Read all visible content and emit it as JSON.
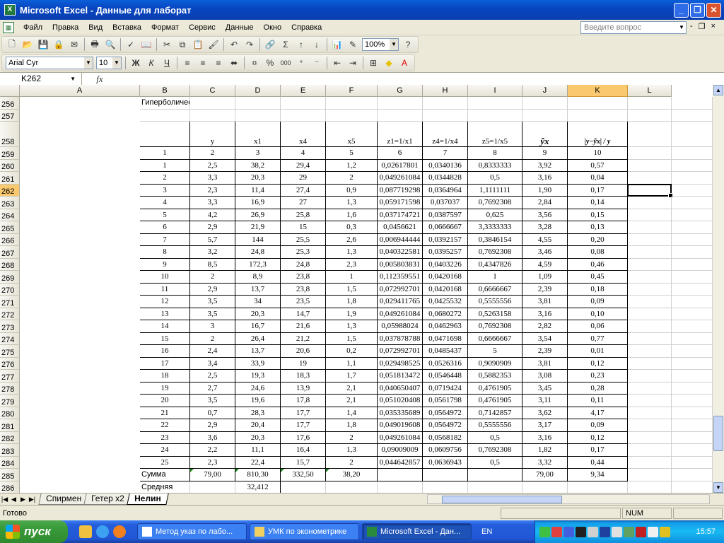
{
  "window": {
    "title": "Microsoft Excel - Данные для лаборат",
    "btn_min": "_",
    "btn_max": "❐",
    "btn_close": "✕"
  },
  "menu": {
    "items": [
      "Файл",
      "Правка",
      "Вид",
      "Вставка",
      "Формат",
      "Сервис",
      "Данные",
      "Окно",
      "Справка"
    ],
    "ask_placeholder": "Введите вопрос",
    "win_min": "-",
    "win_restore": "❐",
    "win_close": "×"
  },
  "toolbar": {
    "zoom": "100%",
    "font": "Arial Cyr",
    "size": "10",
    "bold": "Ж",
    "italic": "К",
    "underline": "Ч",
    "sum": "Σ",
    "percent": "%",
    "thousands": "000"
  },
  "formula": {
    "cell_ref": "K262",
    "fx": "fx",
    "content": ""
  },
  "columns": [
    "A",
    "B",
    "C",
    "D",
    "E",
    "F",
    "G",
    "H",
    "I",
    "J",
    "K",
    "L"
  ],
  "active_column": "K",
  "active_row": "262",
  "rows": [
    {
      "n": "256",
      "cells": [
        "Гиперболическая",
        "",
        "",
        "",
        "",
        "",
        "",
        "",
        "",
        "",
        ""
      ]
    },
    {
      "n": "257",
      "cells": [
        "",
        "",
        "",
        "",
        "",
        "",
        "",
        "",
        "",
        "",
        ""
      ]
    },
    {
      "n": "258",
      "cells": [
        "",
        "y",
        "x1",
        "x4",
        "x5",
        "z1=1/x1",
        "z4=1/x4",
        "z5=1/x5",
        "ỹx",
        "|y−ỹx| / y",
        ""
      ]
    },
    {
      "n": "259",
      "cells": [
        "1",
        "2",
        "3",
        "4",
        "5",
        "6",
        "7",
        "8",
        "9",
        "10",
        ""
      ]
    },
    {
      "n": "260",
      "cells": [
        "1",
        "2,5",
        "38,2",
        "29,4",
        "1,2",
        "0,02617801",
        "0,0340136",
        "0,8333333",
        "3,92",
        "0,57",
        ""
      ]
    },
    {
      "n": "261",
      "cells": [
        "2",
        "3,3",
        "20,3",
        "29",
        "2",
        "0,049261084",
        "0,0344828",
        "0,5",
        "3,16",
        "0,04",
        ""
      ]
    },
    {
      "n": "262",
      "cells": [
        "3",
        "2,3",
        "11,4",
        "27,4",
        "0,9",
        "0,087719298",
        "0,0364964",
        "1,1111111",
        "1,90",
        "0,17",
        ""
      ]
    },
    {
      "n": "263",
      "cells": [
        "4",
        "3,3",
        "16,9",
        "27",
        "1,3",
        "0,059171598",
        "0,037037",
        "0,7692308",
        "2,84",
        "0,14",
        ""
      ]
    },
    {
      "n": "264",
      "cells": [
        "5",
        "4,2",
        "26,9",
        "25,8",
        "1,6",
        "0,037174721",
        "0,0387597",
        "0,625",
        "3,56",
        "0,15",
        ""
      ]
    },
    {
      "n": "265",
      "cells": [
        "6",
        "2,9",
        "21,9",
        "15",
        "0,3",
        "0,0456621",
        "0,0666667",
        "3,3333333",
        "3,28",
        "0,13",
        ""
      ]
    },
    {
      "n": "266",
      "cells": [
        "7",
        "5,7",
        "144",
        "25,5",
        "2,6",
        "0,006944444",
        "0,0392157",
        "0,3846154",
        "4,55",
        "0,20",
        ""
      ]
    },
    {
      "n": "267",
      "cells": [
        "8",
        "3,2",
        "24,8",
        "25,3",
        "1,3",
        "0,040322581",
        "0,0395257",
        "0,7692308",
        "3,46",
        "0,08",
        ""
      ]
    },
    {
      "n": "268",
      "cells": [
        "9",
        "8,5",
        "172,3",
        "24,8",
        "2,3",
        "0,005803831",
        "0,0403226",
        "0,4347826",
        "4,59",
        "0,46",
        ""
      ]
    },
    {
      "n": "269",
      "cells": [
        "10",
        "2",
        "8,9",
        "23,8",
        "1",
        "0,112359551",
        "0,0420168",
        "1",
        "1,09",
        "0,45",
        ""
      ]
    },
    {
      "n": "270",
      "cells": [
        "11",
        "2,9",
        "13,7",
        "23,8",
        "1,5",
        "0,072992701",
        "0,0420168",
        "0,6666667",
        "2,39",
        "0,18",
        ""
      ]
    },
    {
      "n": "271",
      "cells": [
        "12",
        "3,5",
        "34",
        "23,5",
        "1,8",
        "0,029411765",
        "0,0425532",
        "0,5555556",
        "3,81",
        "0,09",
        ""
      ]
    },
    {
      "n": "272",
      "cells": [
        "13",
        "3,5",
        "20,3",
        "14,7",
        "1,9",
        "0,049261084",
        "0,0680272",
        "0,5263158",
        "3,16",
        "0,10",
        ""
      ]
    },
    {
      "n": "273",
      "cells": [
        "14",
        "3",
        "16,7",
        "21,6",
        "1,3",
        "0,05988024",
        "0,0462963",
        "0,7692308",
        "2,82",
        "0,06",
        ""
      ]
    },
    {
      "n": "274",
      "cells": [
        "15",
        "2",
        "26,4",
        "21,2",
        "1,5",
        "0,037878788",
        "0,0471698",
        "0,6666667",
        "3,54",
        "0,77",
        ""
      ]
    },
    {
      "n": "275",
      "cells": [
        "16",
        "2,4",
        "13,7",
        "20,6",
        "0,2",
        "0,072992701",
        "0,0485437",
        "5",
        "2,39",
        "0,01",
        ""
      ]
    },
    {
      "n": "276",
      "cells": [
        "17",
        "3,4",
        "33,9",
        "19",
        "1,1",
        "0,029498525",
        "0,0526316",
        "0,9090909",
        "3,81",
        "0,12",
        ""
      ]
    },
    {
      "n": "277",
      "cells": [
        "18",
        "2,5",
        "19,3",
        "18,3",
        "1,7",
        "0,051813472",
        "0,0546448",
        "0,5882353",
        "3,08",
        "0,23",
        ""
      ]
    },
    {
      "n": "278",
      "cells": [
        "19",
        "2,7",
        "24,6",
        "13,9",
        "2,1",
        "0,040650407",
        "0,0719424",
        "0,4761905",
        "3,45",
        "0,28",
        ""
      ]
    },
    {
      "n": "279",
      "cells": [
        "20",
        "3,5",
        "19,6",
        "17,8",
        "2,1",
        "0,051020408",
        "0,0561798",
        "0,4761905",
        "3,11",
        "0,11",
        ""
      ]
    },
    {
      "n": "280",
      "cells": [
        "21",
        "0,7",
        "28,3",
        "17,7",
        "1,4",
        "0,035335689",
        "0,0564972",
        "0,7142857",
        "3,62",
        "4,17",
        ""
      ]
    },
    {
      "n": "281",
      "cells": [
        "22",
        "2,9",
        "20,4",
        "17,7",
        "1,8",
        "0,049019608",
        "0,0564972",
        "0,5555556",
        "3,17",
        "0,09",
        ""
      ]
    },
    {
      "n": "282",
      "cells": [
        "23",
        "3,6",
        "20,3",
        "17,6",
        "2",
        "0,049261084",
        "0,0568182",
        "0,5",
        "3,16",
        "0,12",
        ""
      ]
    },
    {
      "n": "283",
      "cells": [
        "24",
        "2,2",
        "11,1",
        "16,4",
        "1,3",
        "0,09009009",
        "0,0609756",
        "0,7692308",
        "1,82",
        "0,17",
        ""
      ]
    },
    {
      "n": "284",
      "cells": [
        "25",
        "2,3",
        "22,4",
        "15,7",
        "2",
        "0,044642857",
        "0,0636943",
        "0,5",
        "3,32",
        "0,44",
        ""
      ]
    },
    {
      "n": "285",
      "cells": [
        "Сумма",
        "79,00",
        "810,30",
        "332,50",
        "38,20",
        "",
        "",
        "",
        "79,00",
        "9,34",
        ""
      ]
    },
    {
      "n": "286",
      "cells": [
        "Средняя",
        "",
        "32,412",
        "",
        "",
        "",
        "",
        "",
        "",
        "",
        ""
      ]
    },
    {
      "n": "287",
      "cells": [
        "",
        "",
        "",
        "",
        "",
        "",
        "",
        "",
        "",
        "",
        ""
      ]
    }
  ],
  "tabs": [
    "Спирмен",
    "Гетер х2",
    "Нелин"
  ],
  "active_tab": "Нелин",
  "status": {
    "text": "Готово",
    "num": "NUM"
  },
  "taskbar": {
    "start": "пуск",
    "tasks": [
      "Метод указ по лабо...",
      "УМК по эконометрике",
      "Microsoft Excel - Дан..."
    ],
    "lang": "EN",
    "clock": "15:57"
  }
}
